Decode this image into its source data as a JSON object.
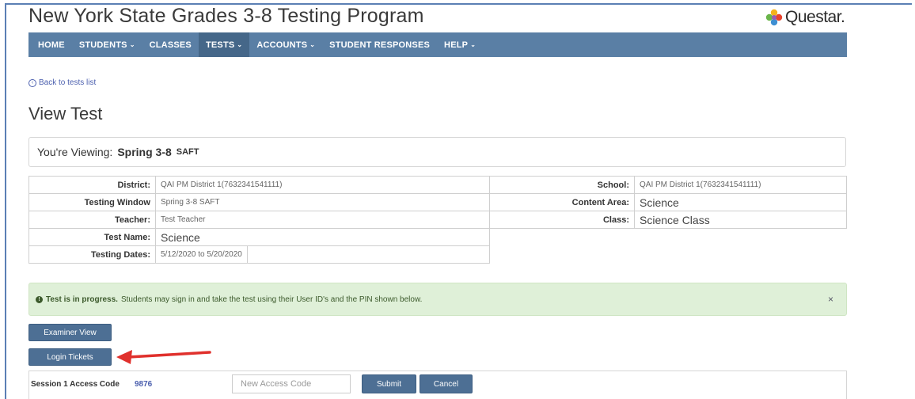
{
  "app": {
    "title": "New York State Grades 3-8 Testing Program",
    "brand": "Questar."
  },
  "nav": {
    "items": [
      {
        "label": "HOME",
        "caret": ""
      },
      {
        "label": "STUDENTS",
        "caret": "⌄"
      },
      {
        "label": "CLASSES",
        "caret": ""
      },
      {
        "label": "TESTS",
        "caret": "⌄"
      },
      {
        "label": "ACCOUNTS",
        "caret": "⌄"
      },
      {
        "label": "STUDENT RESPONSES",
        "caret": ""
      },
      {
        "label": "HELP",
        "caret": "⌄"
      }
    ],
    "active_index": 3
  },
  "back_link": "Back to tests list",
  "page_title": "View Test",
  "viewing": {
    "label": "You're Viewing:",
    "value": "Spring 3-8",
    "sub": "SAFT"
  },
  "info": {
    "district_label": "District:",
    "district_value": "QAI PM District 1(7632341541111)",
    "school_label": "School:",
    "school_value": "QAI PM District 1(7632341541111)",
    "window_label": "Testing Window",
    "window_value": "Spring 3-8 SAFT",
    "content_label": "Content Area:",
    "content_value": "Science",
    "teacher_label": "Teacher:",
    "teacher_value": "Test Teacher",
    "class_label": "Class:",
    "class_value": "Science Class",
    "testname_label": "Test Name:",
    "testname_value": "Science",
    "dates_label": "Testing Dates:",
    "dates_value": "5/12/2020 to 5/20/2020"
  },
  "alert": {
    "icon": "!",
    "strong": "Test is in progress.",
    "text": "Students may sign in and take the test using their User ID's and the PIN shown below.",
    "close": "×"
  },
  "buttons": {
    "examiner": "Examiner View",
    "login": "Login Tickets"
  },
  "session": {
    "label": "Session 1 Access Code",
    "code": "9876",
    "input_placeholder": "New Access Code",
    "submit": "Submit",
    "cancel": "Cancel"
  },
  "colors": {
    "nav": "#5a7fa5",
    "button": "#4d6f94",
    "alert_bg": "#dff0d8",
    "arrow": "#e0302c"
  }
}
